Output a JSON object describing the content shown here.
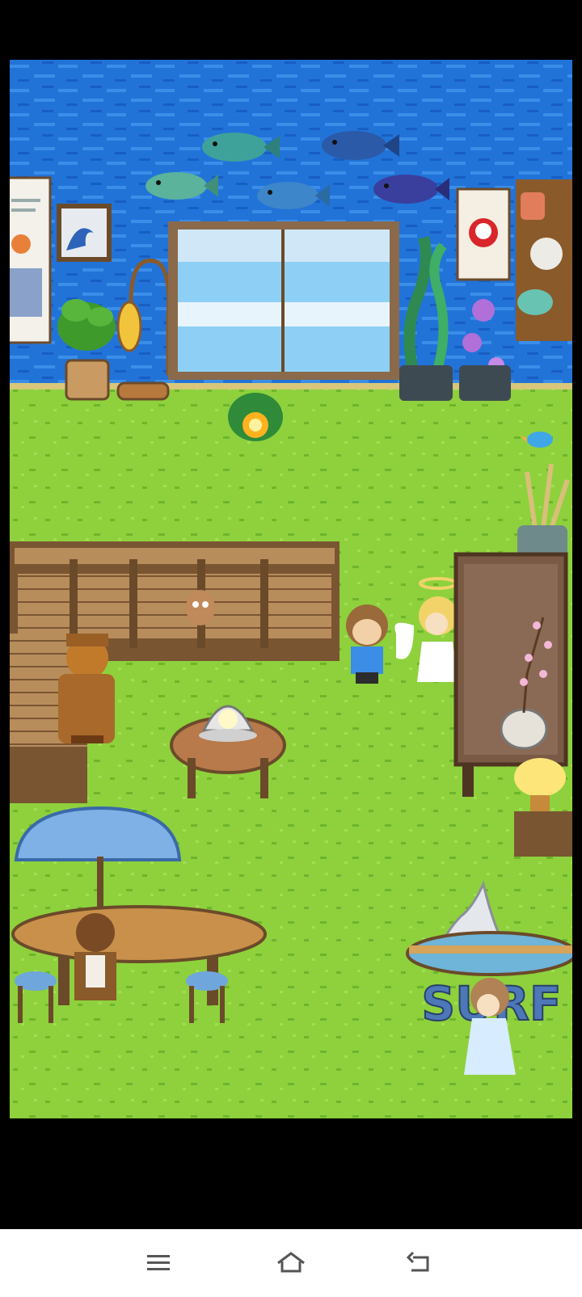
{
  "screen": "grassland-room",
  "colors": {
    "sky": "#1f6fd6",
    "grass": "#8fd13f",
    "wood": "#b58a5a",
    "nav_bg": "#ffffff",
    "nav_icon": "#555555"
  },
  "objects": {
    "surf_sign_text": "SURF"
  },
  "navigation": {
    "menu_icon": "menu-icon",
    "home_icon": "home-icon",
    "back_icon": "back-icon"
  }
}
